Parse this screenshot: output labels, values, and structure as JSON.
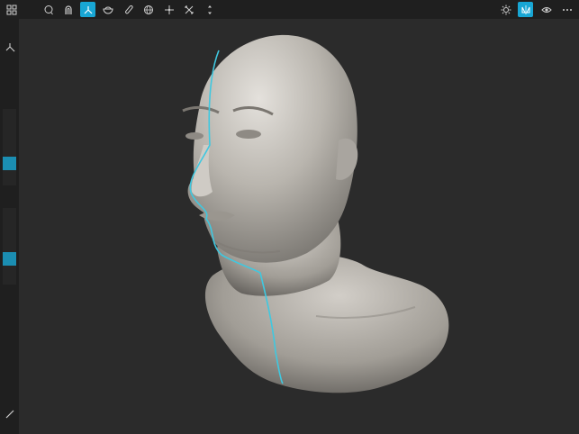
{
  "toolbar": {
    "left": [
      {
        "name": "grid-menu-icon",
        "active": false
      },
      {
        "name": "lasso-select-icon",
        "active": false
      },
      {
        "name": "magnet-icon",
        "active": false
      },
      {
        "name": "move-brush-icon",
        "active": true
      },
      {
        "name": "clay-bowl-icon",
        "active": false
      },
      {
        "name": "pencil-icon",
        "active": false
      },
      {
        "name": "sphere-grid-icon",
        "active": false
      },
      {
        "name": "transform-cross-icon",
        "active": false
      },
      {
        "name": "scale-arrows-icon",
        "active": false
      },
      {
        "name": "more-dots-icon",
        "active": false
      }
    ],
    "right": [
      {
        "name": "settings-sun-icon",
        "active": false
      },
      {
        "name": "symmetry-icon",
        "active": true
      },
      {
        "name": "eye-icon",
        "active": false
      },
      {
        "name": "more-dots-icon",
        "active": false
      }
    ]
  },
  "sidebar": {
    "tool_icon": "move-brush-icon",
    "bottom_icon": "edit-pencil-icon",
    "size_slider": {
      "value": 0.35
    },
    "intensity_slider": {
      "value": 0.35
    }
  },
  "colors": {
    "accent": "#18a6d4",
    "symmetry_line": "#3fc8e0",
    "toolbar_bg": "#1f1f1f",
    "viewport_bg": "#2b2b2b",
    "model": "#b5b1ab"
  }
}
